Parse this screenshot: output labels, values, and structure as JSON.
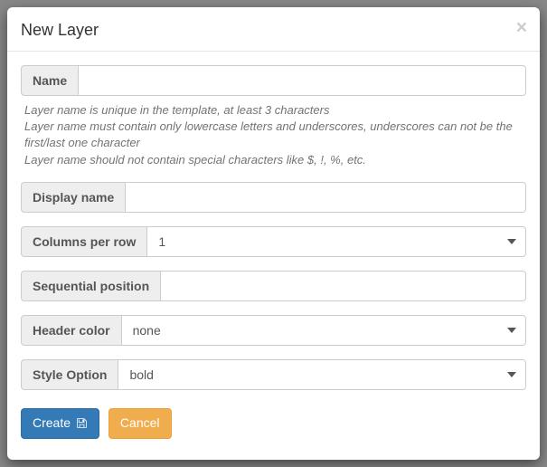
{
  "modal": {
    "title": "New Layer",
    "close_glyph": "×"
  },
  "fields": {
    "name": {
      "label": "Name",
      "value": ""
    },
    "name_help": {
      "line1": "Layer name is unique in the template, at least 3 characters",
      "line2": "Layer name must contain only lowercase letters and underscores, underscores can not be the first/last one character",
      "line3": "Layer name should not contain special characters like $, !, %, etc."
    },
    "display_name": {
      "label": "Display name",
      "value": ""
    },
    "columns_per_row": {
      "label": "Columns per row",
      "selected": "1"
    },
    "sequential_position": {
      "label": "Sequential position",
      "value": ""
    },
    "header_color": {
      "label": "Header color",
      "selected": "none"
    },
    "style_option": {
      "label": "Style Option",
      "selected": "bold"
    }
  },
  "buttons": {
    "create": "Create",
    "cancel": "Cancel"
  }
}
